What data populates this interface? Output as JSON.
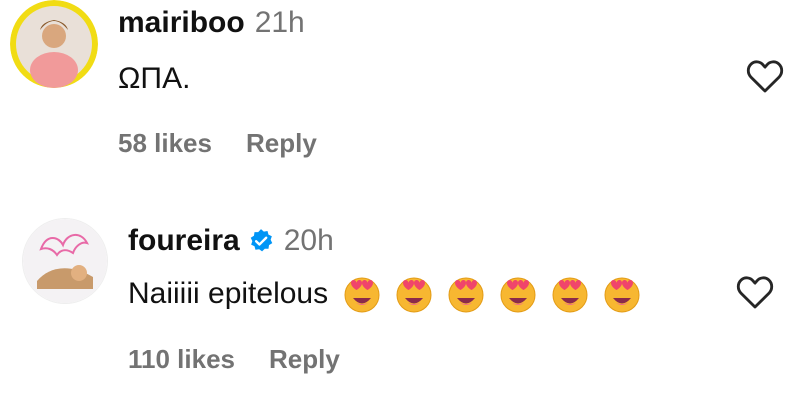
{
  "comments": [
    {
      "username": "mairiboo",
      "time": "21h",
      "text": "ΩΠΑ.",
      "likes": "58 likes",
      "reply": "Reply",
      "verified": false,
      "avatar_icon": "user-photo-avatar"
    },
    {
      "username": "foureira",
      "time": "20h",
      "text": "Naiiiii epitelous",
      "emoji_count": 6,
      "emoji_name": "heart-eyes-emoji",
      "likes": "110 likes",
      "reply": "Reply",
      "verified": true,
      "avatar_icon": "user-photo-avatar"
    }
  ],
  "colors": {
    "muted": "#737373",
    "verified": "#0095f6",
    "avatar_ring": "#f5dd1a"
  }
}
